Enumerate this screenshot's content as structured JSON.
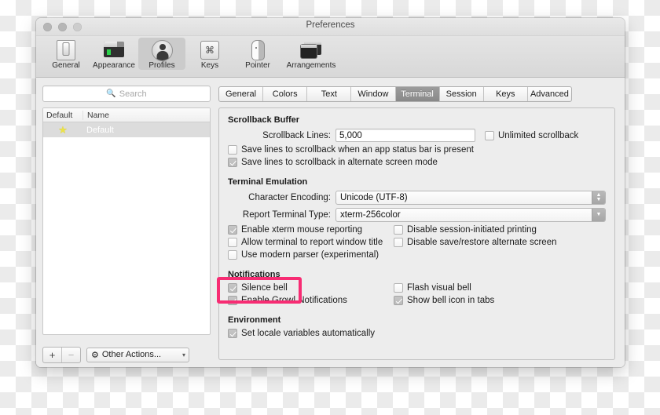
{
  "window": {
    "title": "Preferences",
    "traffic_lights": [
      "close-button",
      "minimize-button",
      "zoom-button"
    ]
  },
  "toolbar": {
    "items": [
      {
        "label": "General",
        "icon": "general-icon",
        "selected": false
      },
      {
        "label": "Appearance",
        "icon": "appearance-icon",
        "selected": false
      },
      {
        "label": "Profiles",
        "icon": "profiles-icon",
        "selected": true
      },
      {
        "label": "Keys",
        "icon": "keys-icon",
        "selected": false
      },
      {
        "label": "Pointer",
        "icon": "pointer-icon",
        "selected": false
      },
      {
        "label": "Arrangements",
        "icon": "arrangements-icon",
        "selected": false
      }
    ]
  },
  "sidebar": {
    "search": {
      "placeholder": "Search",
      "value": "",
      "icon": "search-icon"
    },
    "columns": {
      "default": "Default",
      "name": "Name"
    },
    "profiles": [
      {
        "name": "Default",
        "is_default": true,
        "star": "★",
        "selected": true
      }
    ],
    "footer": {
      "add_label": "+",
      "remove_label": "−",
      "other_actions_label": "Other Actions...",
      "gear_icon": "gear-icon",
      "chevron": "⌄"
    }
  },
  "tabs": [
    {
      "label": "General",
      "active": false
    },
    {
      "label": "Colors",
      "active": false
    },
    {
      "label": "Text",
      "active": false
    },
    {
      "label": "Window",
      "active": false
    },
    {
      "label": "Terminal",
      "active": true
    },
    {
      "label": "Session",
      "active": false
    },
    {
      "label": "Keys",
      "active": false
    },
    {
      "label": "Advanced",
      "active": false
    }
  ],
  "scrollback": {
    "section_title": "Scrollback Buffer",
    "lines_label": "Scrollback Lines:",
    "lines_value": "5,000",
    "unlimited_label": "Unlimited scrollback",
    "unlimited_checked": false,
    "save_app_status_label": "Save lines to scrollback when an app status bar is present",
    "save_app_status_checked": false,
    "save_alternate_label": "Save lines to scrollback in alternate screen mode",
    "save_alternate_checked": true
  },
  "emulation": {
    "section_title": "Terminal Emulation",
    "encoding_label": "Character Encoding:",
    "encoding_value": "Unicode (UTF-8)",
    "terminal_type_label": "Report Terminal Type:",
    "terminal_type_value": "xterm-256color",
    "xterm_mouse_label": "Enable xterm mouse reporting",
    "xterm_mouse_checked": true,
    "report_title_label": "Allow terminal to report window title",
    "report_title_checked": false,
    "modern_parser_label": "Use modern parser (experimental)",
    "modern_parser_checked": false,
    "disable_printing_label": "Disable session-initiated printing",
    "disable_printing_checked": false,
    "disable_alt_screen_label": "Disable save/restore alternate screen",
    "disable_alt_screen_checked": false
  },
  "notifications": {
    "section_title": "Notifications",
    "silence_bell_label": "Silence bell",
    "silence_bell_checked": true,
    "growl_label": "Enable Growl Notifications",
    "growl_checked": true,
    "flash_visual_bell_label": "Flash visual bell",
    "flash_visual_bell_checked": false,
    "bell_icon_tabs_label": "Show bell icon in tabs",
    "bell_icon_tabs_checked": true
  },
  "environment": {
    "section_title": "Environment",
    "locale_label": "Set locale variables automatically",
    "locale_checked": true
  },
  "annotation": {
    "highlight_color": "#f72c73",
    "highlight_target": "silence-bell-checkbox"
  }
}
